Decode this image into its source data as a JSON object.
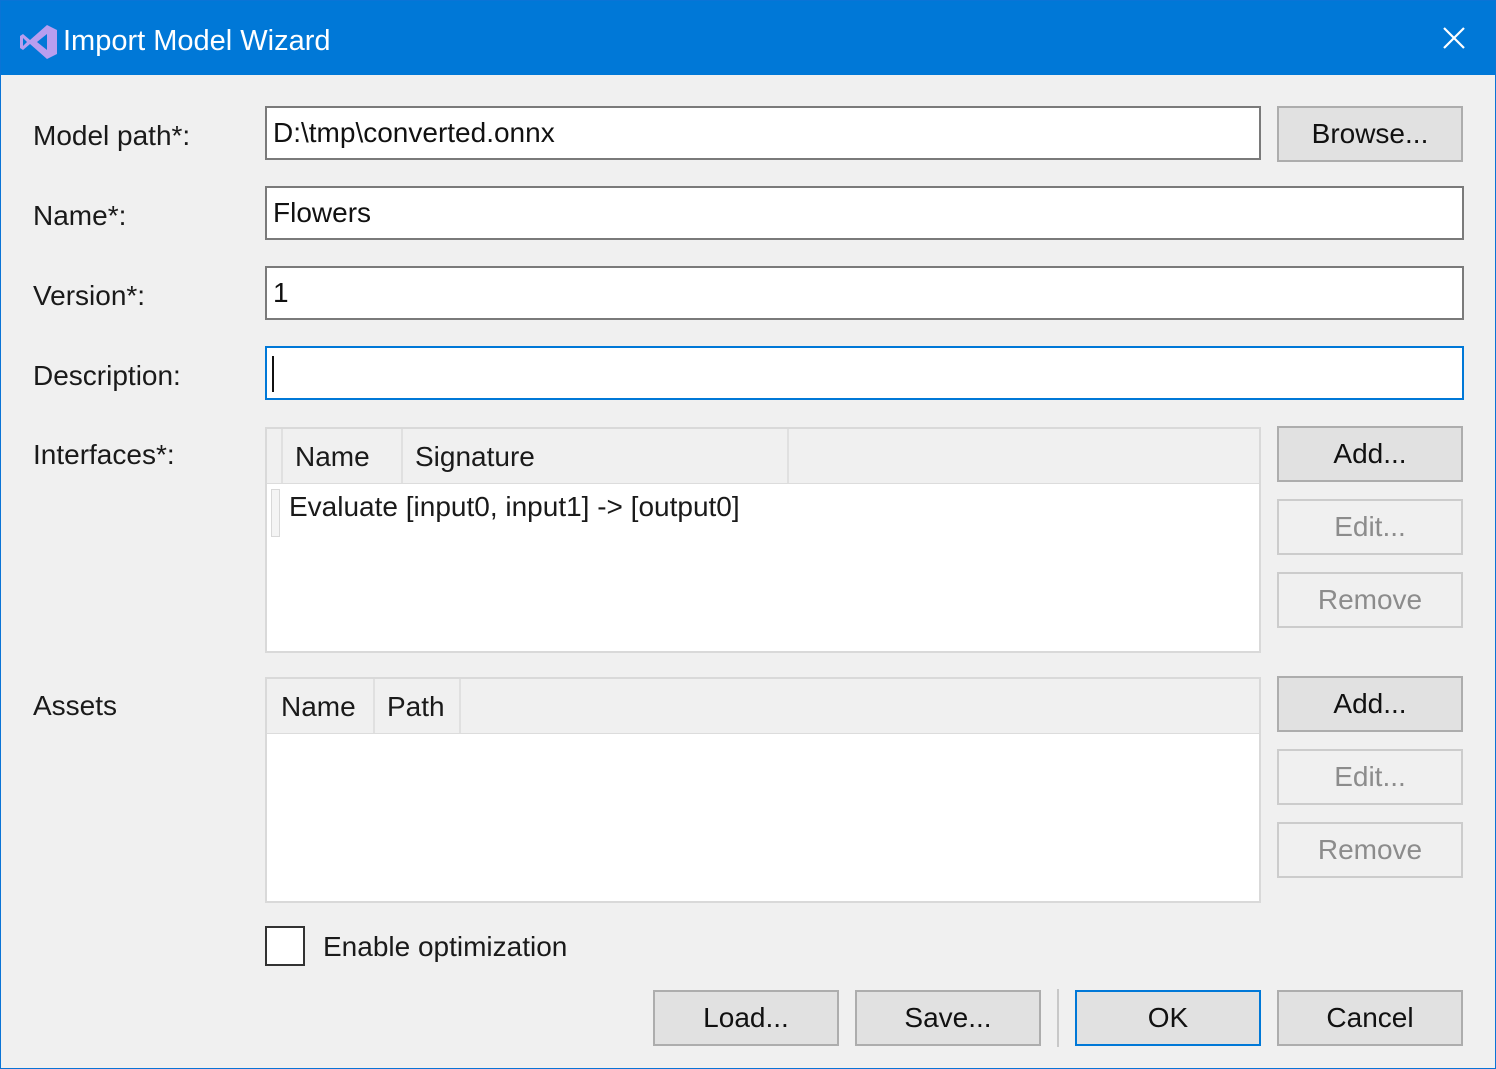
{
  "window": {
    "title": "Import Model Wizard",
    "app_icon": "visual-studio-icon",
    "close_icon": "close-icon",
    "accent_color": "#0078d7"
  },
  "form": {
    "model_path": {
      "label": "Model path*:",
      "value": "D:\\tmp\\converted.onnx",
      "browse_label": "Browse..."
    },
    "name": {
      "label": "Name*:",
      "value": "Flowers"
    },
    "version": {
      "label": "Version*:",
      "value": "1"
    },
    "description": {
      "label": "Description:",
      "value": ""
    }
  },
  "interfaces": {
    "label": "Interfaces*:",
    "columns": [
      "Name",
      "Signature"
    ],
    "rows": [
      {
        "name": "Evaluate",
        "signature": "[input0, input1] -> [output0]"
      }
    ],
    "add_label": "Add...",
    "edit_label": "Edit...",
    "remove_label": "Remove"
  },
  "assets": {
    "label": "Assets",
    "columns": [
      "Name",
      "Path"
    ],
    "rows": [],
    "add_label": "Add...",
    "edit_label": "Edit...",
    "remove_label": "Remove"
  },
  "options": {
    "enable_optimization_label": "Enable optimization",
    "enable_optimization_checked": false
  },
  "footer": {
    "load_label": "Load...",
    "save_label": "Save...",
    "ok_label": "OK",
    "cancel_label": "Cancel"
  }
}
